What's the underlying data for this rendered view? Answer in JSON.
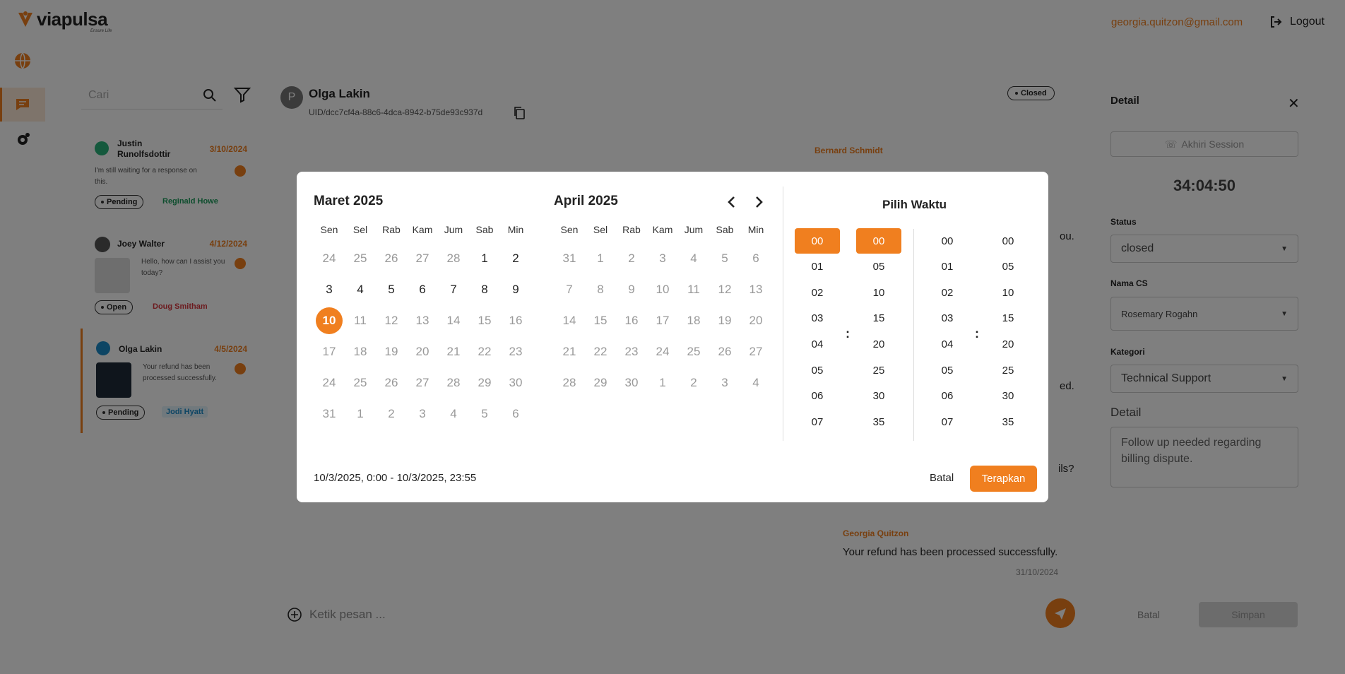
{
  "topbar": {
    "brand": "viapulsa",
    "tagline": "Ensure Life",
    "user_email": "georgia.quitzon@gmail.com",
    "logout_label": "Logout"
  },
  "search": {
    "placeholder": "Cari"
  },
  "conversations": [
    {
      "name_line1": "Justin",
      "name_line2": "Runolfsdottir",
      "date": "3/10/2024",
      "message": "I'm still waiting for a response on this.",
      "status": "Pending",
      "agent": "Reginald Howe",
      "agent_color": "#1a9a5a"
    },
    {
      "name_line1": "Joey Walter",
      "name_line2": "",
      "date": "4/12/2024",
      "message": "Hello, how can I assist you today?",
      "status": "Open",
      "agent": "Doug Smitham",
      "agent_color": "#d9363e"
    },
    {
      "name_line1": "Olga Lakin",
      "name_line2": "",
      "date": "4/5/2024",
      "message": "Your refund has been processed successfully.",
      "status": "Pending",
      "agent": "Jodi Hyatt",
      "agent_color": "#1a8ac8"
    }
  ],
  "chat": {
    "avatar_letter": "P",
    "name": "Olga Lakin",
    "uid": "UID/dcc7cf4a-88c6-4dca-8942-b75de93c937d",
    "status": "Closed",
    "sender1": "Bernard Schmidt",
    "frag1": "ou.",
    "frag2": "ed.",
    "frag3": "ils?",
    "sender2": "Georgia Quitzon",
    "last_message": "Your refund has been processed successfully.",
    "last_time": "31/10/2024",
    "input_placeholder": "Ketik pesan ..."
  },
  "detail": {
    "title": "Detail",
    "end_session": "Akhiri Session",
    "timer": "34:04:50",
    "status_label": "Status",
    "status_value": "closed",
    "cs_label": "Nama CS",
    "cs_value": "Rosemary Rogahn",
    "category_label": "Kategori",
    "category_value": "Technical Support",
    "detail_label": "Detail",
    "detail_text": "Follow up needed regarding billing dispute.",
    "cancel": "Batal",
    "save": "Simpan"
  },
  "datepicker": {
    "left_month": "Maret 2025",
    "right_month": "April 2025",
    "weekdays": [
      "Sen",
      "Sel",
      "Rab",
      "Kam",
      "Jum",
      "Sab",
      "Min"
    ],
    "left_weeks": [
      [
        "24",
        "25",
        "26",
        "27",
        "28",
        "1",
        "2"
      ],
      [
        "3",
        "4",
        "5",
        "6",
        "7",
        "8",
        "9"
      ],
      [
        "10",
        "11",
        "12",
        "13",
        "14",
        "15",
        "16"
      ],
      [
        "17",
        "18",
        "19",
        "20",
        "21",
        "22",
        "23"
      ],
      [
        "24",
        "25",
        "26",
        "27",
        "28",
        "29",
        "30"
      ],
      [
        "31",
        "1",
        "2",
        "3",
        "4",
        "5",
        "6"
      ]
    ],
    "right_weeks": [
      [
        "31",
        "1",
        "2",
        "3",
        "4",
        "5",
        "6"
      ],
      [
        "7",
        "8",
        "9",
        "10",
        "11",
        "12",
        "13"
      ],
      [
        "14",
        "15",
        "16",
        "17",
        "18",
        "19",
        "20"
      ],
      [
        "21",
        "22",
        "23",
        "24",
        "25",
        "26",
        "27"
      ],
      [
        "28",
        "29",
        "30",
        "1",
        "2",
        "3",
        "4"
      ]
    ],
    "selected_day": "10",
    "time_title": "Pilih Waktu",
    "hours": [
      "00",
      "01",
      "02",
      "03",
      "04",
      "05",
      "06",
      "07"
    ],
    "minutes": [
      "00",
      "05",
      "10",
      "15",
      "20",
      "25",
      "30",
      "35"
    ],
    "colon": ":",
    "range_text": "10/3/2025, 0:00 - 10/3/2025, 23:55",
    "cancel": "Batal",
    "apply": "Terapkan",
    "accent": "#f07f1f"
  }
}
